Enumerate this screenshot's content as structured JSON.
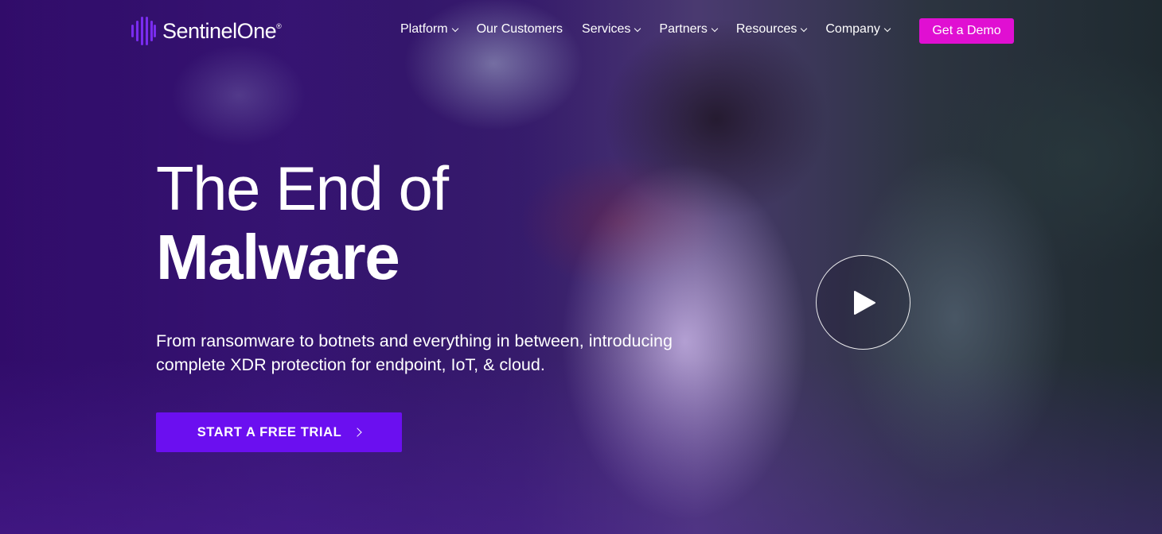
{
  "brand": {
    "name_part1": "Sentinel",
    "name_part2": "One",
    "registered": "®",
    "logo_icon": "sentinelone-bars-icon",
    "accent_color": "#6b0ff0",
    "demo_color": "#e00fd2"
  },
  "nav": {
    "items": [
      {
        "label": "Platform",
        "has_dropdown": true
      },
      {
        "label": "Our Customers",
        "has_dropdown": false
      },
      {
        "label": "Services",
        "has_dropdown": true
      },
      {
        "label": "Partners",
        "has_dropdown": true
      },
      {
        "label": "Resources",
        "has_dropdown": true
      },
      {
        "label": "Company",
        "has_dropdown": true
      }
    ],
    "demo_button": "Get a Demo"
  },
  "hero": {
    "headline_line1": "The End of",
    "headline_line2": "Malware",
    "subhead": "From ransomware to botnets and everything in between, introducing complete XDR protection for endpoint, IoT, & cloud.",
    "cta_label": "START A FREE TRIAL",
    "play_icon": "play-icon"
  }
}
